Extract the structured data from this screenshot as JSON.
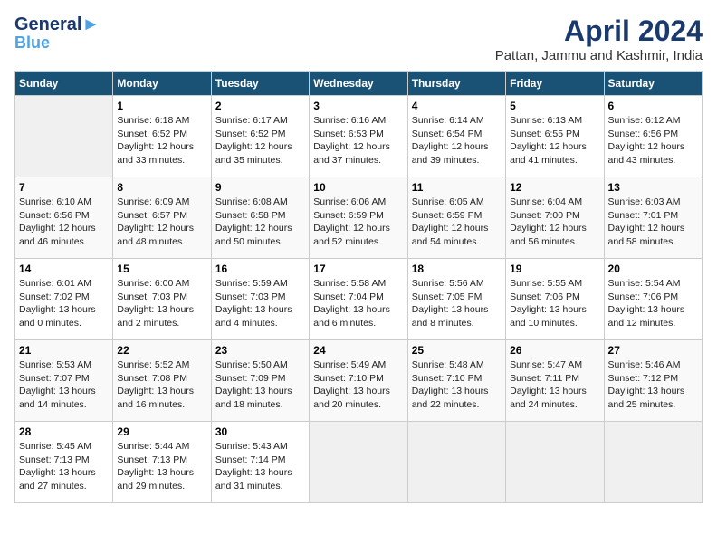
{
  "logo": {
    "line1": "General",
    "line2": "Blue"
  },
  "title": "April 2024",
  "subtitle": "Pattan, Jammu and Kashmir, India",
  "days_of_week": [
    "Sunday",
    "Monday",
    "Tuesday",
    "Wednesday",
    "Thursday",
    "Friday",
    "Saturday"
  ],
  "weeks": [
    [
      {
        "date": "",
        "info": ""
      },
      {
        "date": "1",
        "info": "Sunrise: 6:18 AM\nSunset: 6:52 PM\nDaylight: 12 hours\nand 33 minutes."
      },
      {
        "date": "2",
        "info": "Sunrise: 6:17 AM\nSunset: 6:52 PM\nDaylight: 12 hours\nand 35 minutes."
      },
      {
        "date": "3",
        "info": "Sunrise: 6:16 AM\nSunset: 6:53 PM\nDaylight: 12 hours\nand 37 minutes."
      },
      {
        "date": "4",
        "info": "Sunrise: 6:14 AM\nSunset: 6:54 PM\nDaylight: 12 hours\nand 39 minutes."
      },
      {
        "date": "5",
        "info": "Sunrise: 6:13 AM\nSunset: 6:55 PM\nDaylight: 12 hours\nand 41 minutes."
      },
      {
        "date": "6",
        "info": "Sunrise: 6:12 AM\nSunset: 6:56 PM\nDaylight: 12 hours\nand 43 minutes."
      }
    ],
    [
      {
        "date": "7",
        "info": "Sunrise: 6:10 AM\nSunset: 6:56 PM\nDaylight: 12 hours\nand 46 minutes."
      },
      {
        "date": "8",
        "info": "Sunrise: 6:09 AM\nSunset: 6:57 PM\nDaylight: 12 hours\nand 48 minutes."
      },
      {
        "date": "9",
        "info": "Sunrise: 6:08 AM\nSunset: 6:58 PM\nDaylight: 12 hours\nand 50 minutes."
      },
      {
        "date": "10",
        "info": "Sunrise: 6:06 AM\nSunset: 6:59 PM\nDaylight: 12 hours\nand 52 minutes."
      },
      {
        "date": "11",
        "info": "Sunrise: 6:05 AM\nSunset: 6:59 PM\nDaylight: 12 hours\nand 54 minutes."
      },
      {
        "date": "12",
        "info": "Sunrise: 6:04 AM\nSunset: 7:00 PM\nDaylight: 12 hours\nand 56 minutes."
      },
      {
        "date": "13",
        "info": "Sunrise: 6:03 AM\nSunset: 7:01 PM\nDaylight: 12 hours\nand 58 minutes."
      }
    ],
    [
      {
        "date": "14",
        "info": "Sunrise: 6:01 AM\nSunset: 7:02 PM\nDaylight: 13 hours\nand 0 minutes."
      },
      {
        "date": "15",
        "info": "Sunrise: 6:00 AM\nSunset: 7:03 PM\nDaylight: 13 hours\nand 2 minutes."
      },
      {
        "date": "16",
        "info": "Sunrise: 5:59 AM\nSunset: 7:03 PM\nDaylight: 13 hours\nand 4 minutes."
      },
      {
        "date": "17",
        "info": "Sunrise: 5:58 AM\nSunset: 7:04 PM\nDaylight: 13 hours\nand 6 minutes."
      },
      {
        "date": "18",
        "info": "Sunrise: 5:56 AM\nSunset: 7:05 PM\nDaylight: 13 hours\nand 8 minutes."
      },
      {
        "date": "19",
        "info": "Sunrise: 5:55 AM\nSunset: 7:06 PM\nDaylight: 13 hours\nand 10 minutes."
      },
      {
        "date": "20",
        "info": "Sunrise: 5:54 AM\nSunset: 7:06 PM\nDaylight: 13 hours\nand 12 minutes."
      }
    ],
    [
      {
        "date": "21",
        "info": "Sunrise: 5:53 AM\nSunset: 7:07 PM\nDaylight: 13 hours\nand 14 minutes."
      },
      {
        "date": "22",
        "info": "Sunrise: 5:52 AM\nSunset: 7:08 PM\nDaylight: 13 hours\nand 16 minutes."
      },
      {
        "date": "23",
        "info": "Sunrise: 5:50 AM\nSunset: 7:09 PM\nDaylight: 13 hours\nand 18 minutes."
      },
      {
        "date": "24",
        "info": "Sunrise: 5:49 AM\nSunset: 7:10 PM\nDaylight: 13 hours\nand 20 minutes."
      },
      {
        "date": "25",
        "info": "Sunrise: 5:48 AM\nSunset: 7:10 PM\nDaylight: 13 hours\nand 22 minutes."
      },
      {
        "date": "26",
        "info": "Sunrise: 5:47 AM\nSunset: 7:11 PM\nDaylight: 13 hours\nand 24 minutes."
      },
      {
        "date": "27",
        "info": "Sunrise: 5:46 AM\nSunset: 7:12 PM\nDaylight: 13 hours\nand 25 minutes."
      }
    ],
    [
      {
        "date": "28",
        "info": "Sunrise: 5:45 AM\nSunset: 7:13 PM\nDaylight: 13 hours\nand 27 minutes."
      },
      {
        "date": "29",
        "info": "Sunrise: 5:44 AM\nSunset: 7:13 PM\nDaylight: 13 hours\nand 29 minutes."
      },
      {
        "date": "30",
        "info": "Sunrise: 5:43 AM\nSunset: 7:14 PM\nDaylight: 13 hours\nand 31 minutes."
      },
      {
        "date": "",
        "info": ""
      },
      {
        "date": "",
        "info": ""
      },
      {
        "date": "",
        "info": ""
      },
      {
        "date": "",
        "info": ""
      }
    ]
  ]
}
